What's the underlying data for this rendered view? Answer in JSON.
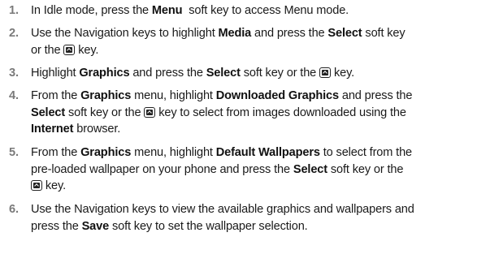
{
  "steps": [
    {
      "number": "1.",
      "t1": "In Idle mode, press the ",
      "b1": "Menu",
      "t2": "  soft key to access Menu mode."
    },
    {
      "number": "2.",
      "t1": "Use the Navigation keys to highlight ",
      "b1": "Media",
      "t2": " and press the ",
      "b2": "Select",
      "t3": " soft key",
      "t4": "or the ",
      "icon": "select-key-icon",
      "t5": " key."
    },
    {
      "number": "3.",
      "t1": "Highlight ",
      "b1": "Graphics",
      "t2": " and press the ",
      "b2": "Select",
      "t3": " soft key or the ",
      "icon": "select-key-icon",
      "t4": " key."
    },
    {
      "number": "4.",
      "t1": "From the ",
      "b1": "Graphics",
      "t2": " menu, highlight ",
      "b2": "Downloaded Graphics",
      "t3": " and press the",
      "b3": "Select",
      "t4": " soft key or the ",
      "icon": "select-key-icon",
      "t5": " key to select from images downloaded using the",
      "b4": "Internet",
      "t6": " browser."
    },
    {
      "number": "5.",
      "t1": "From the ",
      "b1": "Graphics",
      "t2": " menu, highlight ",
      "b2": "Default Wallpapers",
      "t3": " to select from the",
      "t4": "pre-loaded wallpaper on your phone and press the ",
      "b3": "Select",
      "t5": " soft key or the",
      "icon": "select-key-icon",
      "t6": " key."
    },
    {
      "number": "6.",
      "t1": "Use the Navigation keys to view the available graphics and wallpapers and",
      "t2": "press the ",
      "b1": "Save",
      "t3": " soft key to set the wallpaper selection."
    }
  ]
}
